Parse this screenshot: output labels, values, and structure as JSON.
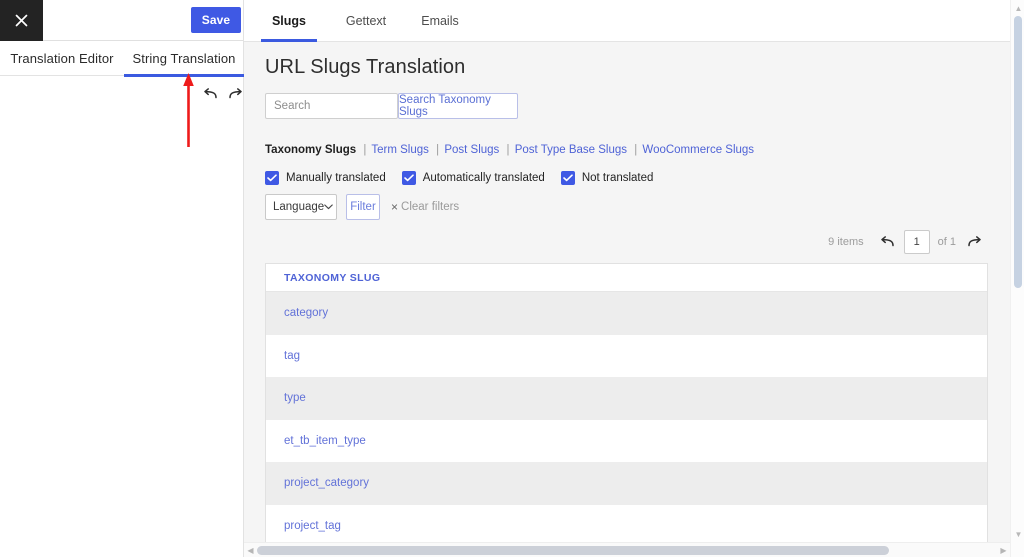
{
  "left_panel": {
    "close_icon": "close-icon",
    "save_label": "Save",
    "tabs": [
      {
        "label": "Translation Editor",
        "active": false
      },
      {
        "label": "String Translation",
        "active": true
      }
    ],
    "history": {
      "undo_icon": "undo-arrow-icon",
      "redo_icon": "redo-arrow-icon"
    },
    "annotation": {
      "type": "red-up-arrow",
      "color": "#ee1b1b",
      "points_to": "String Translation"
    }
  },
  "top_tabs": [
    {
      "label": "Slugs",
      "active": true
    },
    {
      "label": "Gettext",
      "active": false
    },
    {
      "label": "Emails",
      "active": false
    }
  ],
  "main": {
    "title": "URL Slugs Translation",
    "search": {
      "value": "",
      "placeholder": "Search",
      "button_label": "Search Taxonomy Slugs"
    },
    "slug_links": {
      "current": "Taxonomy Slugs",
      "links": [
        "Term Slugs",
        "Post Slugs",
        "Post Type Base Slugs",
        "WooCommerce Slugs"
      ],
      "separator": "|"
    },
    "checkboxes": [
      {
        "label": "Manually translated",
        "checked": true
      },
      {
        "label": "Automatically translated",
        "checked": true
      },
      {
        "label": "Not translated",
        "checked": true
      }
    ],
    "controls": {
      "language_label": "Language",
      "language_caret": "chevron-down-icon",
      "filter_label": "Filter",
      "clear_filters_label": "Clear filters",
      "clear_filters_x": "×"
    },
    "pagination": {
      "items_count": "9 items",
      "prev_icon": "prev-arrow-icon",
      "next_icon": "next-arrow-icon",
      "page_value": "1",
      "of_text": "of 1"
    },
    "table": {
      "columns": [
        "TAXONOMY SLUG"
      ],
      "rows": [
        {
          "slug": "category"
        },
        {
          "slug": "tag"
        },
        {
          "slug": "type"
        },
        {
          "slug": "et_tb_item_type"
        },
        {
          "slug": "project_category"
        },
        {
          "slug": "project_tag"
        }
      ]
    }
  },
  "colors": {
    "accent": "#3f59e4",
    "link": "#4f63d6",
    "annotation": "#ee1b1b",
    "row_alt": "#ededed"
  }
}
